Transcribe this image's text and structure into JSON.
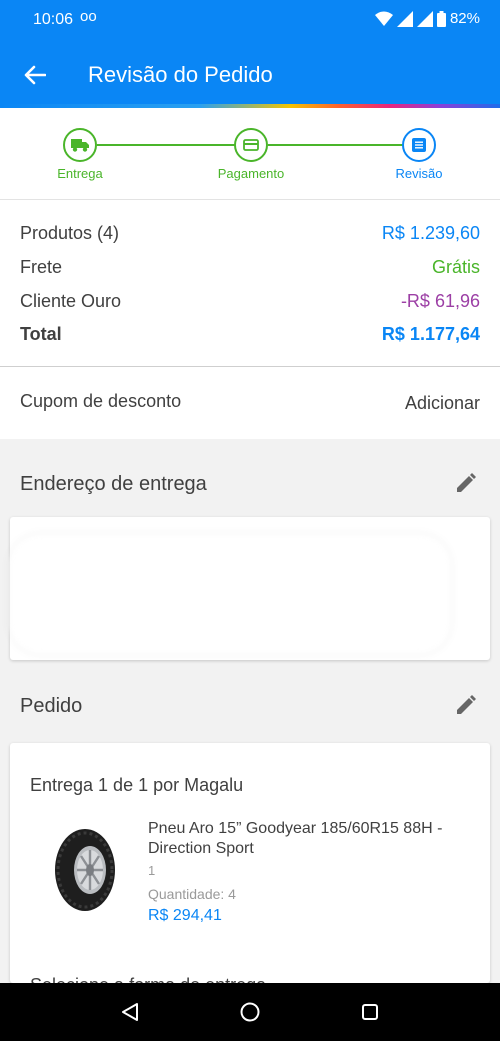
{
  "status_bar": {
    "time": "10:06",
    "voicemail": "oo",
    "battery": "82%"
  },
  "app_bar": {
    "title": "Revisão do Pedido"
  },
  "stepper": {
    "steps": [
      {
        "label": "Entrega",
        "icon": "truck-icon"
      },
      {
        "label": "Pagamento",
        "icon": "card-icon"
      },
      {
        "label": "Revisão",
        "icon": "list-icon"
      }
    ]
  },
  "summary": {
    "rows": [
      {
        "label": "Produtos (4)",
        "value": "R$ 1.239,60"
      },
      {
        "label": "Frete",
        "value": "Grátis"
      },
      {
        "label": "Cliente Ouro",
        "value": "-R$ 61,96"
      },
      {
        "label": "Total",
        "value": "R$ 1.177,64"
      }
    ]
  },
  "coupon": {
    "label": "Cupom de desconto",
    "action": "Adicionar"
  },
  "address": {
    "title": "Endereço de entrega"
  },
  "order": {
    "title": "Pedido",
    "delivery_heading": "Entrega 1 de 1 por Magalu",
    "product": {
      "name": "Pneu Aro 15” Goodyear 185/60R15 88H - Direction Sport",
      "small_qty": "1",
      "quantity": "Quantidade:  4",
      "price": "R$ 294,41"
    },
    "cut_text": "Selecione a forma de entrega"
  },
  "colors": {
    "primary": "#0a86f5",
    "success": "#4ab52a",
    "discount": "#9c3fa5"
  }
}
